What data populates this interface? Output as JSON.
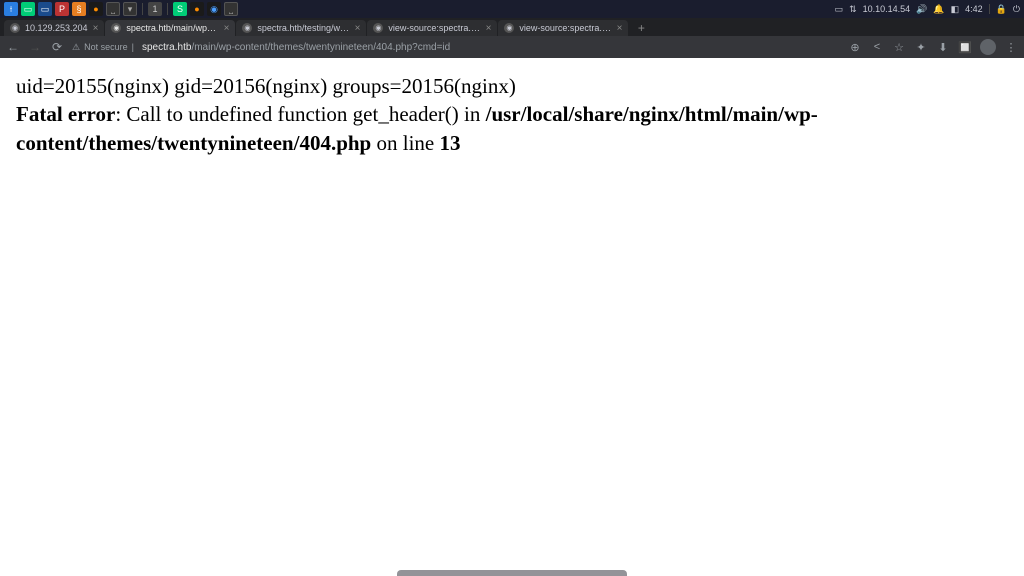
{
  "os": {
    "ip_label": "10.10.14.54",
    "time": "4:42"
  },
  "tabs": [
    {
      "title": "10.129.253.204",
      "active": false
    },
    {
      "title": "spectra.htb/main/wp-co",
      "active": true
    },
    {
      "title": "spectra.htb/testing/wp-c",
      "active": false
    },
    {
      "title": "view-source:spectra.htb/i",
      "active": false
    },
    {
      "title": "view-source:spectra.htb/i",
      "active": false
    }
  ],
  "addr": {
    "security_text": "Not secure",
    "domain": "spectra.htb",
    "path": "/main/wp-content/themes/twentynineteen/404.php?cmd=id"
  },
  "page": {
    "cmd_output": "uid=20155(nginx) gid=20156(nginx) groups=20156(nginx)",
    "error_label": "Fatal error",
    "error_msg1": ": Call to undefined function get_header() in ",
    "error_path": "/usr/local/share/nginx/html/main/wp-content/themes/twentynineteen/404.php",
    "error_msg2": " on line ",
    "error_line": "13"
  }
}
